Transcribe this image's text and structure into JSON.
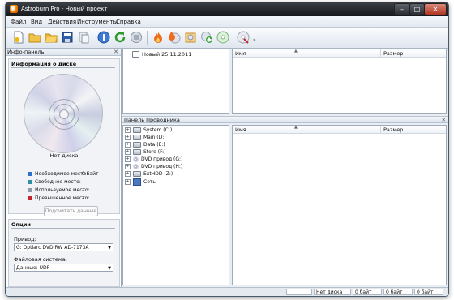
{
  "window": {
    "title": "Astroburn Pro - Новый проект",
    "minimize_glyph": "–",
    "maximize_glyph": "□",
    "close_glyph": "✕"
  },
  "menu": [
    "Файл",
    "Вид",
    "Действия",
    "Инструменты",
    "Справка"
  ],
  "toolbar": {
    "buttons": [
      "new-project-icon",
      "open-folder-icon",
      "open-file-icon",
      "save-icon",
      "copy-disc-icon",
      "info-icon",
      "refresh-icon",
      "stop-icon",
      "burn-icon",
      "burn-image-icon",
      "edit-image-icon",
      "add-icon",
      "disc-icon",
      "disc-erase-icon"
    ],
    "more_glyph": "»"
  },
  "info_panel": {
    "header": "Инфо-панель",
    "close_glyph": "✕",
    "section_title": "Информация о диске",
    "disc_status": "Нет диска",
    "legend": [
      {
        "label": "Необходимое место:",
        "value": "0 байт",
        "color": "#2d6fcf"
      },
      {
        "label": "Свободное место:",
        "value": "-",
        "color": "#2f8fa8"
      },
      {
        "label": "Используемое место:",
        "value": "-",
        "color": "#8a9aa6"
      },
      {
        "label": "Превышенное место:",
        "value": "-",
        "color": "#c0262b"
      }
    ],
    "calc_button": "Подсчитать данные"
  },
  "options": {
    "title": "Опции",
    "drive_label": "Привод:",
    "drive_value": "G: Optiarc DVD RW AD-7173A",
    "fs_label": "Файловая система:",
    "fs_value": "Данные: UDF",
    "dropdown_glyph": "▼"
  },
  "project": {
    "tree_root": "Новый 25.11.2011",
    "columns": {
      "name": "Имя",
      "size": "Размер"
    },
    "sort_glyph": "▲"
  },
  "explorer": {
    "header": "Панель Проводника",
    "close_glyph": "✕",
    "expander_glyph": "+",
    "drives": [
      {
        "label": "System (C:)",
        "icon": "hdd-icon"
      },
      {
        "label": "Main (D:)",
        "icon": "hdd-icon"
      },
      {
        "label": "Data (E:)",
        "icon": "hdd-icon"
      },
      {
        "label": "Store (F:)",
        "icon": "hdd-icon"
      },
      {
        "label": "DVD привод (G:)",
        "icon": "dvd-icon"
      },
      {
        "label": "DVD привод (H:)",
        "icon": "dvd-icon"
      },
      {
        "label": "ExtHDD (Z:)",
        "icon": "hdd-icon"
      },
      {
        "label": "Сеть",
        "icon": "network-icon"
      }
    ],
    "columns": {
      "name": "Имя",
      "size": "Размер"
    },
    "sort_glyph": "▲"
  },
  "statusbar": {
    "disc": "Нет диска",
    "cells": [
      "0 байт",
      "0 байт",
      "0 байт"
    ]
  }
}
